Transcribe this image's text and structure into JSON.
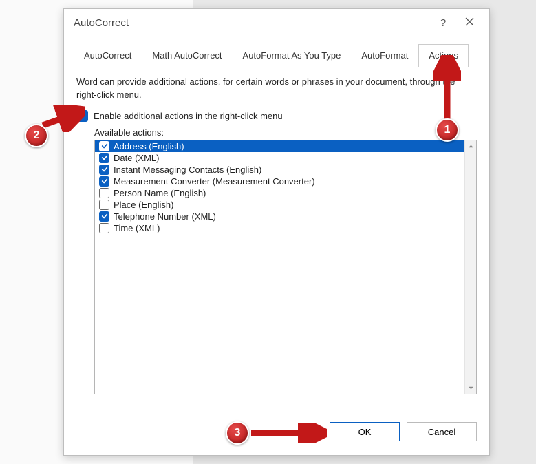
{
  "dialog": {
    "title": "AutoCorrect",
    "help": "?",
    "tabs": [
      {
        "label": "AutoCorrect"
      },
      {
        "label": "Math AutoCorrect"
      },
      {
        "label": "AutoFormat As You Type"
      },
      {
        "label": "AutoFormat"
      },
      {
        "label": "Actions"
      }
    ],
    "description": "Word can provide additional actions, for certain words or phrases in your document, through the right-click menu.",
    "enable_label": "Enable additional actions in the right-click menu",
    "available_label": "Available actions:",
    "items": [
      {
        "label": "Address (English)",
        "checked": true,
        "selected": true
      },
      {
        "label": "Date (XML)",
        "checked": true,
        "selected": false
      },
      {
        "label": "Instant Messaging Contacts (English)",
        "checked": true,
        "selected": false
      },
      {
        "label": "Measurement Converter (Measurement Converter)",
        "checked": true,
        "selected": false
      },
      {
        "label": "Person Name (English)",
        "checked": false,
        "selected": false
      },
      {
        "label": "Place (English)",
        "checked": false,
        "selected": false
      },
      {
        "label": "Telephone Number (XML)",
        "checked": true,
        "selected": false
      },
      {
        "label": "Time (XML)",
        "checked": false,
        "selected": false
      }
    ],
    "ok": "OK",
    "cancel": "Cancel"
  },
  "annotations": {
    "b1": "1",
    "b2": "2",
    "b3": "3"
  }
}
